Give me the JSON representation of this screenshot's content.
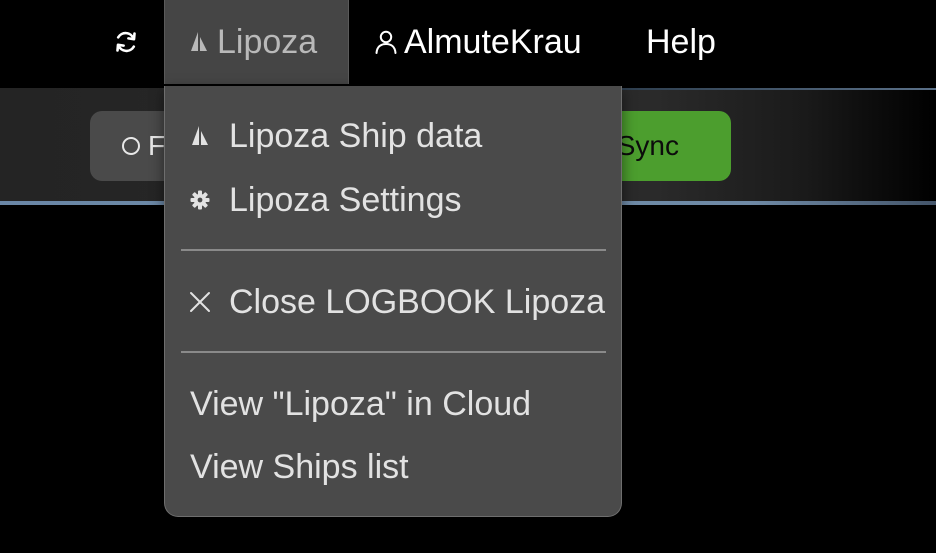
{
  "menubar": {
    "refresh_icon": "refresh-icon",
    "ship": {
      "label": "Lipoza",
      "icon": "sailboat-icon"
    },
    "user": {
      "label": "AlmuteKrau",
      "icon": "user-icon"
    },
    "help_label": "Help"
  },
  "toolbar": {
    "mode_button_label": "F",
    "mode_button_icon": "radio-icon",
    "sync_label": "Sync",
    "sync_color": "#4c9e2e"
  },
  "dropdown": {
    "items": [
      {
        "label": "Lipoza Ship data",
        "icon": "sailboat-icon"
      },
      {
        "label": "Lipoza Settings",
        "icon": "gear-icon"
      },
      {
        "label": "Close LOGBOOK Lipoza",
        "icon": "close-icon"
      },
      {
        "label": "View \"Lipoza\" in Cloud"
      },
      {
        "label": "View Ships list"
      }
    ]
  },
  "colors": {
    "menubar_bg": "#000000",
    "active_menu_bg": "#454545",
    "dropdown_bg": "#4a4a4a",
    "accent_rule": "#6f8aa6"
  }
}
